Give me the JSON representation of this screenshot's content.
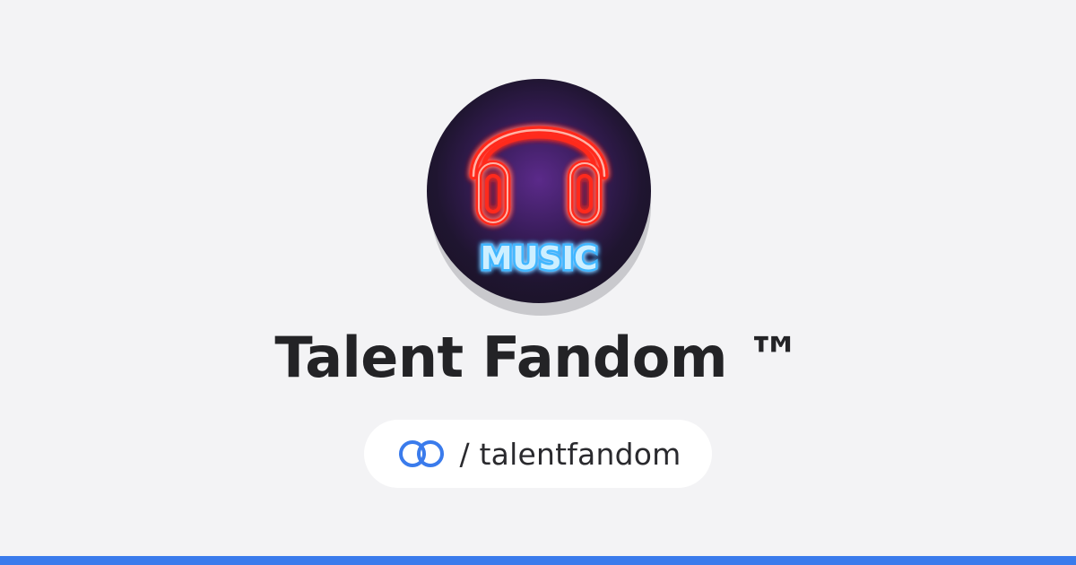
{
  "profile": {
    "name": "Talent Fandom ™",
    "avatar_badge_text": "MUSIC",
    "handle": "/ talentfandom"
  },
  "icons": {
    "avatar_graphic": "neon-headphones-icon",
    "link_icon": "linked-rings-icon"
  },
  "colors": {
    "background": "#f3f3f5",
    "title": "#232326",
    "accent": "#3a7bec",
    "neon_red": "#ff3b30",
    "neon_blue": "#7fd6ff"
  }
}
